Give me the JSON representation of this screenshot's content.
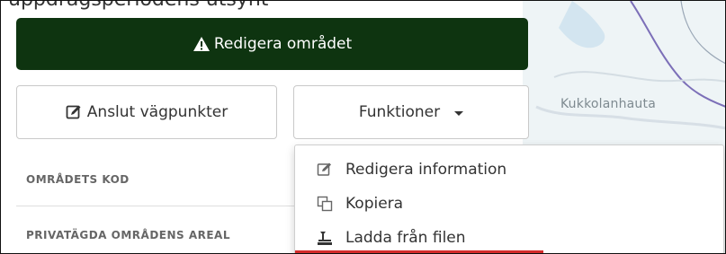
{
  "header": {
    "cut_text": "uppdragsperiodens utsynt"
  },
  "map": {
    "place_label": "Kukkolanhauta"
  },
  "actions": {
    "edit_area_label": "Redigera området",
    "connect_waypoints_label": "Anslut vägpunkter",
    "functions_label": "Funktioner"
  },
  "fields": [
    {
      "label": "OMRÅDETS KOD"
    },
    {
      "label": "PRIVATÄGDA OMRÅDENS AREAL"
    }
  ],
  "functions_menu": {
    "items": [
      {
        "label": "Redigera information",
        "icon": "edit-icon"
      },
      {
        "label": "Kopiera",
        "icon": "copy-icon"
      },
      {
        "label": "Ladda från filen",
        "icon": "upload-icon"
      }
    ]
  },
  "colors": {
    "primary_button": "#0e3410",
    "highlight": "#d42b2b",
    "map_background": "#eef4f6",
    "map_line": "#7c6fb8"
  }
}
